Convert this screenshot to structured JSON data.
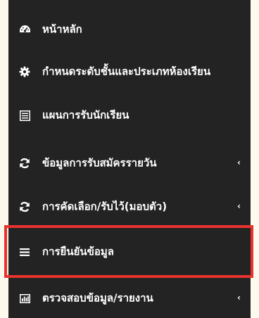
{
  "menu": {
    "items": [
      {
        "label": "หน้าหลัก",
        "icon": "dashboard-icon",
        "has_submenu": false
      },
      {
        "label": "กำหนดระดับชั้นและประเภทห้องเรียน",
        "icon": "gear-icon",
        "has_submenu": false
      },
      {
        "label": "แผนการรับนักเรียน",
        "icon": "list-document-icon",
        "has_submenu": false
      },
      {
        "label": "ข้อมูลการรับสมัครรายวัน",
        "icon": "refresh-icon",
        "has_submenu": true
      },
      {
        "label": "การคัดเลือก/รับไว้(มอบตัว)",
        "icon": "refresh-icon",
        "has_submenu": true
      },
      {
        "label": "การยืนยันข้อมูล",
        "icon": "bars-icon",
        "has_submenu": false
      },
      {
        "label": "ตรวจสอบข้อมูล/รายงาน",
        "icon": "bar-chart-icon",
        "has_submenu": true
      }
    ],
    "chevron_glyph": "‹"
  },
  "highlight": {
    "target": "การยืนยันข้อมูล",
    "color": "#e8322e"
  },
  "colors": {
    "sidebar_bg": "#232323",
    "page_bg": "#fdf9ec",
    "text": "#ffffff"
  }
}
